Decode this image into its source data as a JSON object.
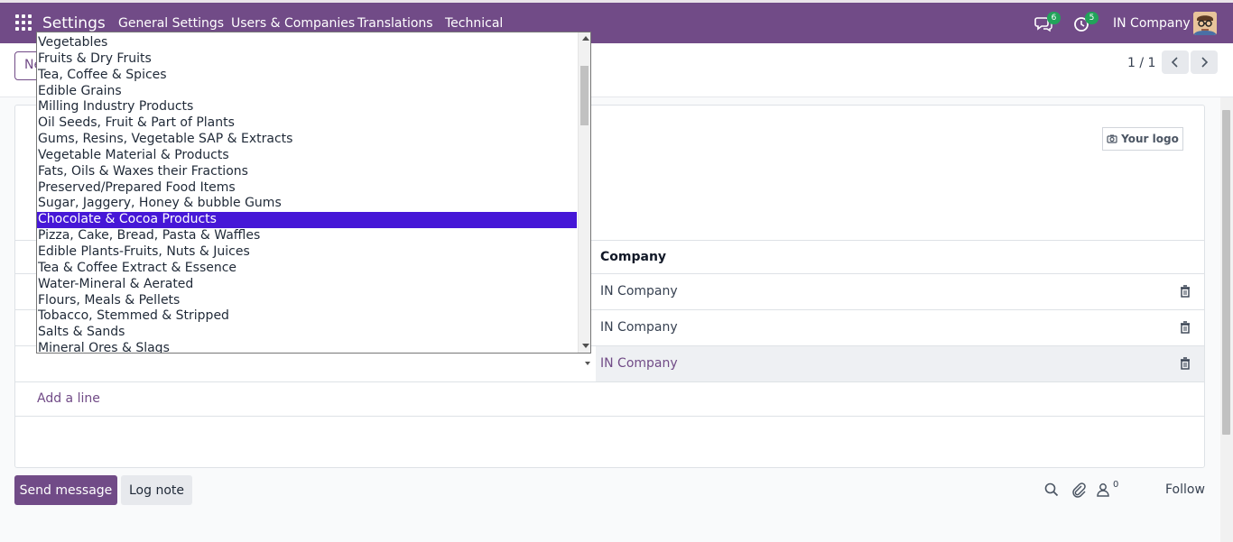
{
  "navbar": {
    "brand": "Settings",
    "menu": [
      "General Settings",
      "Users & Companies",
      "Translations",
      "Technical"
    ],
    "messages_count": "6",
    "activities_count": "5",
    "company": "IN Company",
    "color": "#714b87"
  },
  "control_panel": {
    "new_label": "Ne",
    "pager": "1 / 1"
  },
  "form": {
    "logo_label": "Your logo",
    "table": {
      "header_company": "Company",
      "rows": [
        {
          "company": "IN Company"
        },
        {
          "company": "IN Company"
        },
        {
          "company": "IN Company"
        }
      ],
      "add_line": "Add a line"
    }
  },
  "chatter": {
    "send_message": "Send message",
    "log_note": "Log note",
    "followers_count": "0",
    "follow": "Follow"
  },
  "dropdown": {
    "selected_index": 11,
    "options": [
      "Vegetables",
      "Fruits & Dry Fruits",
      "Tea, Coffee & Spices",
      "Edible Grains",
      "Milling Industry Products",
      "Oil Seeds, Fruit & Part of Plants",
      "Gums, Resins, Vegetable SAP & Extracts",
      "Vegetable Material & Products",
      "Fats, Oils & Waxes their Fractions",
      "Preserved/Prepared Food Items",
      "Sugar, Jaggery, Honey & bubble Gums",
      "Chocolate & Cocoa Products",
      "Pizza, Cake, Bread, Pasta & Waffles",
      "Edible Plants-Fruits, Nuts & Juices",
      "Tea & Coffee Extract & Essence",
      "Water-Mineral & Aerated",
      "Flours, Meals & Pellets",
      "Tobacco, Stemmed & Stripped",
      "Salts & Sands",
      "Mineral Ores & Slags"
    ],
    "selected_color": "#4617d7"
  }
}
